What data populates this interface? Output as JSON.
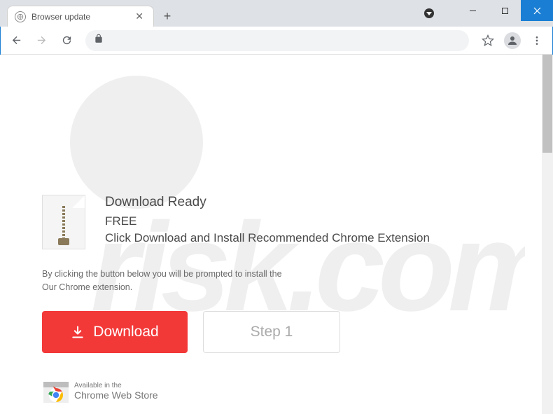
{
  "window": {
    "tab_title": "Browser update"
  },
  "page": {
    "heading": "Download Ready",
    "subheading": "FREE",
    "instruction": "Click Download and Install Recommended Chrome Extension",
    "disclaimer_line1": "By clicking the button below you will be prompted to install the",
    "disclaimer_line2": "Our Chrome extension.",
    "download_button": "Download",
    "step_button": "Step 1"
  },
  "webstore": {
    "line1": "Available in the",
    "line2": "Chrome Web Store"
  }
}
